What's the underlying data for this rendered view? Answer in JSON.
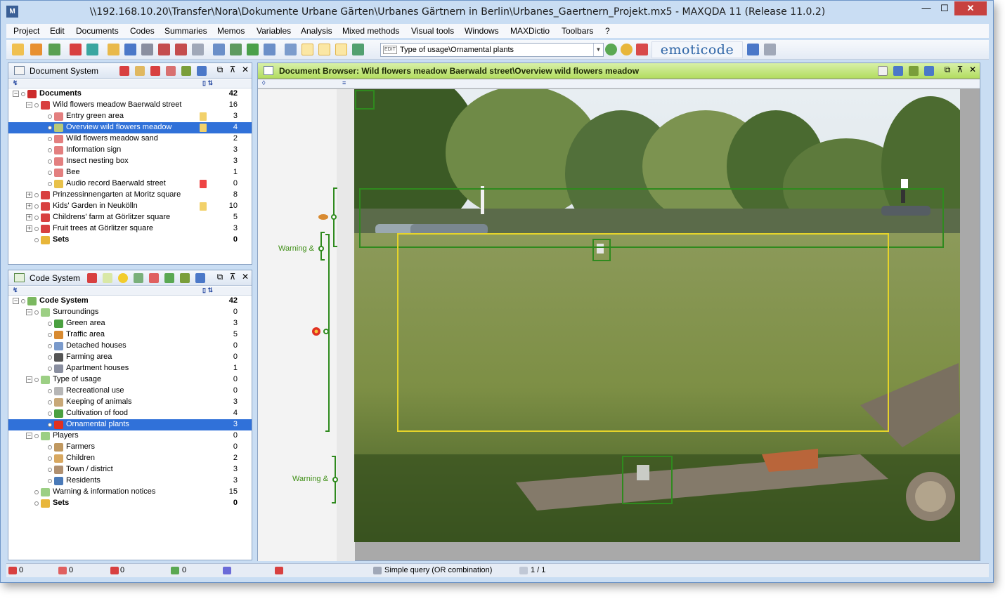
{
  "window": {
    "title": "\\\\192.168.10.20\\Transfer\\Nora\\Dokumente Urbane Gärten\\Urbanes Gärtnern in Berlin\\Urbanes_Gaertnern_Projekt.mx5 - MAXQDA 11  (Release 11.0.2)",
    "minimize": "—",
    "maximize": "☐",
    "close": "✕"
  },
  "menu": [
    "Project",
    "Edit",
    "Documents",
    "Codes",
    "Summaries",
    "Memos",
    "Variables",
    "Analysis",
    "Mixed methods",
    "Visual tools",
    "Windows",
    "MAXDictio",
    "Toolbars",
    "?"
  ],
  "toolbar": {
    "combo_badge": "EDIT",
    "combo_value": "Type of usage\\Ornamental plants",
    "combo_arrow": "▼",
    "emoticode": "emoticode"
  },
  "document_system": {
    "title": "Document System",
    "sub_left": "↯",
    "sub_right": "▯  ⇅",
    "rows": [
      {
        "label": "Documents",
        "count": "42",
        "bold": true
      },
      {
        "label": "Wild flowers meadow Baerwald street",
        "count": "16"
      },
      {
        "label": "Entry green area",
        "count": "3"
      },
      {
        "label": "Overview wild flowers meadow",
        "count": "4"
      },
      {
        "label": "Wild flowers meadow sand",
        "count": "2"
      },
      {
        "label": "Information sign",
        "count": "3"
      },
      {
        "label": "Insect nesting box",
        "count": "3"
      },
      {
        "label": "Bee",
        "count": "1"
      },
      {
        "label": "Audio record Baerwald street",
        "count": "0"
      },
      {
        "label": "Prinzessinnengarten at Moritz square",
        "count": "8"
      },
      {
        "label": "Kids' Garden in Neukölln",
        "count": "10"
      },
      {
        "label": "Childrens' farm at Görlitzer square",
        "count": "5"
      },
      {
        "label": "Fruit trees at Görlitzer square",
        "count": "3"
      },
      {
        "label": "Sets",
        "count": "0",
        "bold": true
      }
    ]
  },
  "code_system": {
    "title": "Code System",
    "sub_left": "↯",
    "sub_right": "▯  ⇅",
    "rows": [
      {
        "label": "Code System",
        "count": "42",
        "bold": true
      },
      {
        "label": "Surroundings",
        "count": "0"
      },
      {
        "label": "Green area",
        "count": "3"
      },
      {
        "label": "Traffic area",
        "count": "5"
      },
      {
        "label": "Detached houses",
        "count": "0"
      },
      {
        "label": "Farming area",
        "count": "0"
      },
      {
        "label": "Apartment houses",
        "count": "1"
      },
      {
        "label": "Type of usage",
        "count": "0"
      },
      {
        "label": "Recreational use",
        "count": "0"
      },
      {
        "label": "Keeping of animals",
        "count": "3"
      },
      {
        "label": "Cultivation of food",
        "count": "4"
      },
      {
        "label": "Ornamental plants",
        "count": "3"
      },
      {
        "label": "Players",
        "count": "0"
      },
      {
        "label": "Farmers",
        "count": "0"
      },
      {
        "label": "Children",
        "count": "2"
      },
      {
        "label": "Town / district",
        "count": "3"
      },
      {
        "label": "Residents",
        "count": "3"
      },
      {
        "label": "Warning & information notices",
        "count": "15"
      },
      {
        "label": "Sets",
        "count": "0",
        "bold": true
      }
    ]
  },
  "document_browser": {
    "title": "Document Browser: Wild flowers meadow Baerwald street\\Overview wild flowers meadow",
    "warning_label_1": "Warning &",
    "warning_label_2": "Warning &",
    "sub_left": "◊",
    "sub_right": "≡"
  },
  "status": {
    "docs": "0",
    "codes": "0",
    "memos": "0",
    "links": "0",
    "query": "Simple query (OR combination)",
    "page": "1 / 1"
  },
  "colors": {
    "selection": "#3071d9",
    "doc_header": "#b3dd61",
    "green_frame": "#2f8a1e",
    "yellow_frame": "#e6d42a"
  }
}
